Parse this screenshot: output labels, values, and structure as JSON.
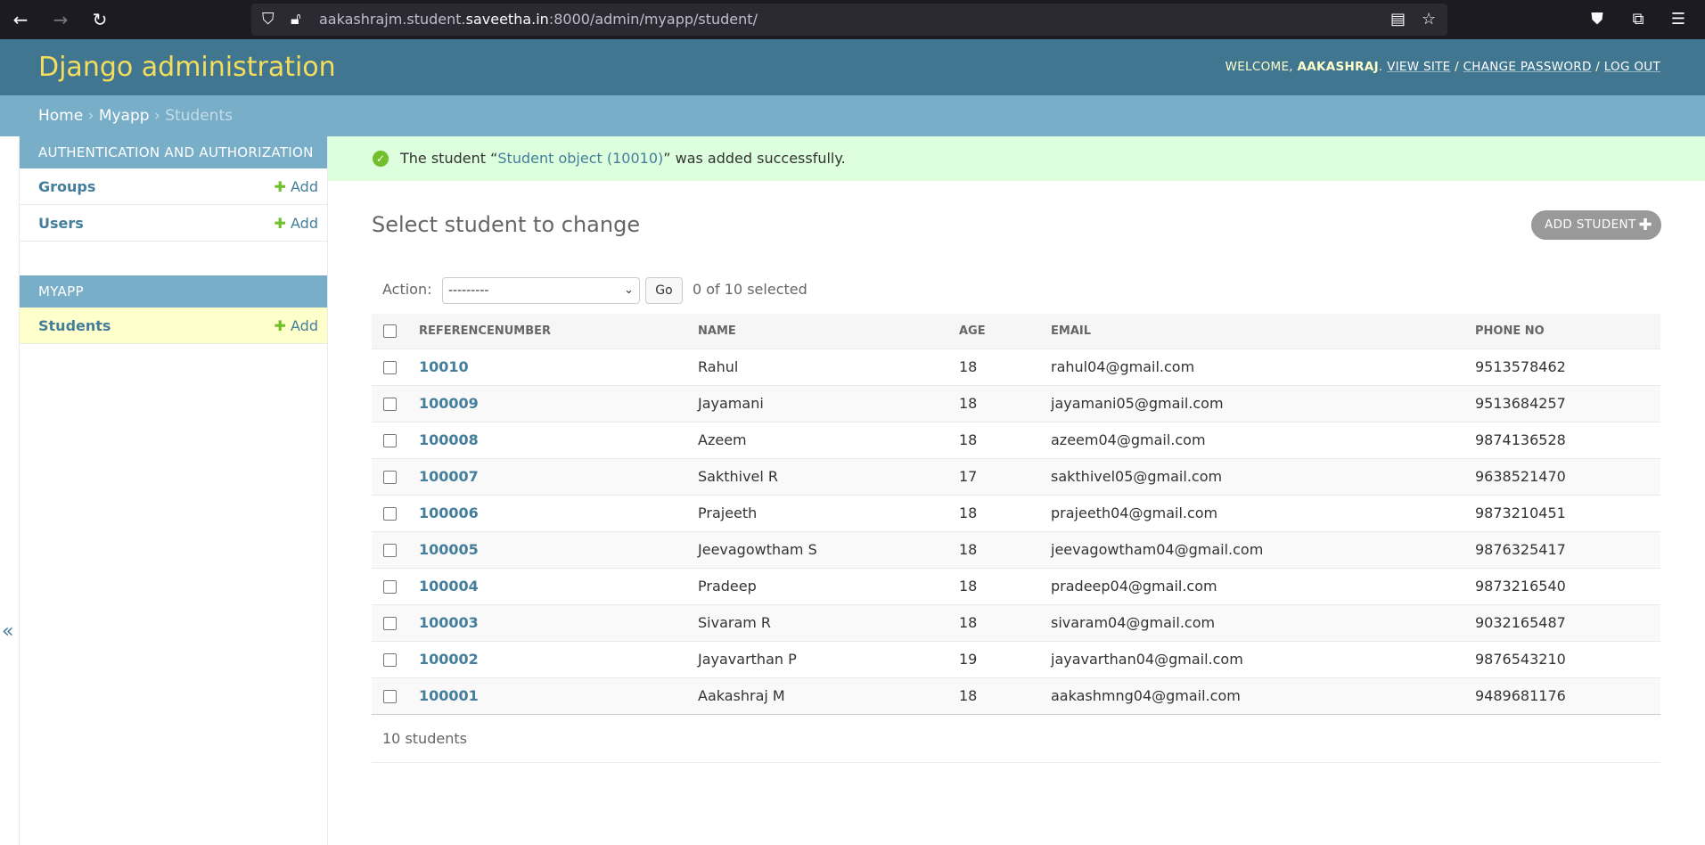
{
  "browser": {
    "url_prefix": "aakashrajm.student.",
    "url_host": "saveetha.in",
    "url_suffix": ":8000/admin/myapp/student/"
  },
  "header": {
    "site_name": "Django administration",
    "welcome": "WELCOME,",
    "username": "AAKASHRAJ",
    "view_site": "VIEW SITE",
    "change_password": "CHANGE PASSWORD",
    "log_out": "LOG OUT",
    "separator": "/"
  },
  "breadcrumbs": {
    "home": "Home",
    "app": "Myapp",
    "current": "Students",
    "sep": "›"
  },
  "sidebar": {
    "modules": [
      {
        "caption": "Authentication and Authorization",
        "models": [
          {
            "name": "Groups",
            "add": "Add"
          },
          {
            "name": "Users",
            "add": "Add"
          }
        ]
      },
      {
        "caption": "Myapp",
        "models": [
          {
            "name": "Students",
            "add": "Add"
          }
        ]
      }
    ]
  },
  "message": {
    "prefix": "The student “",
    "link": "Student object (10010)",
    "suffix": "” was added successfully."
  },
  "main": {
    "title": "Select student to change",
    "add_button": "ADD STUDENT",
    "action_label": "Action:",
    "action_value": "---------",
    "go": "Go",
    "selected": "0 of 10 selected",
    "columns": [
      "REFERENCENUMBER",
      "NAME",
      "AGE",
      "EMAIL",
      "PHONE NO"
    ],
    "rows": [
      [
        "10010",
        "Rahul",
        "18",
        "rahul04@gmail.com",
        "9513578462"
      ],
      [
        "100009",
        "Jayamani",
        "18",
        "jayamani05@gmail.com",
        "9513684257"
      ],
      [
        "100008",
        "Azeem",
        "18",
        "azeem04@gmail.com",
        "9874136528"
      ],
      [
        "100007",
        "Sakthivel R",
        "17",
        "sakthivel05@gmail.com",
        "9638521470"
      ],
      [
        "100006",
        "Prajeeth",
        "18",
        "prajeeth04@gmail.com",
        "9873210451"
      ],
      [
        "100005",
        "Jeevagowtham S",
        "18",
        "jeevagowtham04@gmail.com",
        "9876325417"
      ],
      [
        "100004",
        "Pradeep",
        "18",
        "pradeep04@gmail.com",
        "9873216540"
      ],
      [
        "100003",
        "Sivaram R",
        "18",
        "sivaram04@gmail.com",
        "9032165487"
      ],
      [
        "100002",
        "Jayavarthan P",
        "19",
        "jayavarthan04@gmail.com",
        "9876543210"
      ],
      [
        "100001",
        "Aakashraj M",
        "18",
        "aakashmng04@gmail.com",
        "9489681176"
      ]
    ],
    "paginator": "10 students"
  },
  "colors": {
    "header_bg": "#417690",
    "site_name": "#f5dd5d",
    "breadcrumb_bg": "#79aec8",
    "link": "#447e9b",
    "success_bg": "#dfddff",
    "add_green": "#70bf2b"
  }
}
